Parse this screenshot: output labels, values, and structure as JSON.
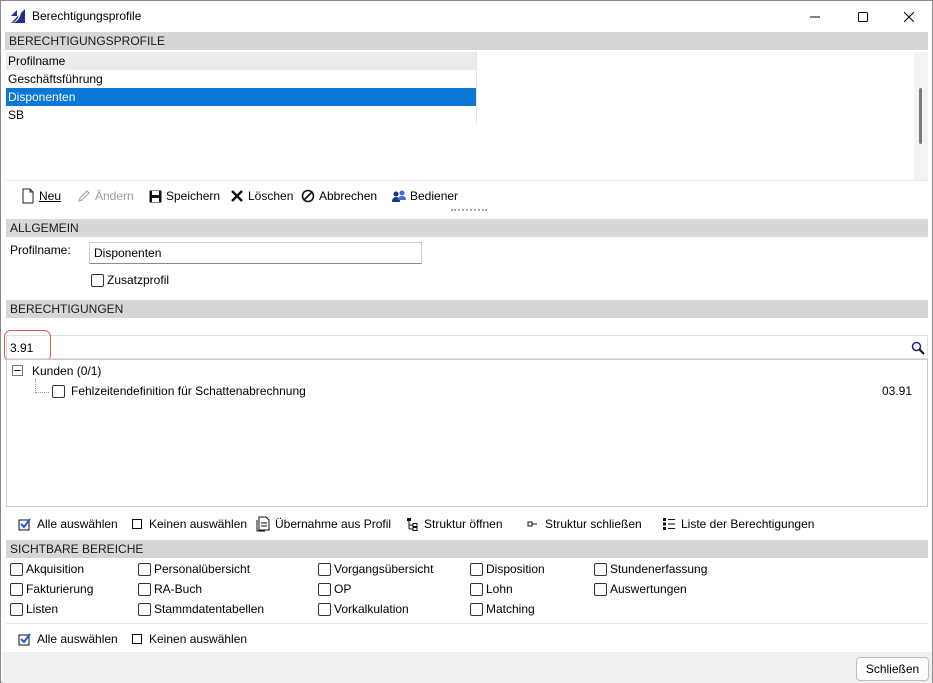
{
  "window": {
    "title": "Berechtigungsprofile",
    "controls": [
      "minimize",
      "maximize",
      "close"
    ]
  },
  "profiles": {
    "header": "BERECHTIGUNGSPROFILE",
    "column": "Profilname",
    "rows": [
      "Geschäftsführung",
      "Disponenten",
      "SB"
    ],
    "selected": "Disponenten"
  },
  "toolbar": {
    "new": "Neu",
    "edit": "Ändern",
    "save": "Speichern",
    "delete": "Löschen",
    "cancel": "Abbrechen",
    "users": "Bediener"
  },
  "general": {
    "header": "ALLGEMEIN",
    "profile_label": "Profilname:",
    "profile_value": "Disponenten",
    "additional_profile": "Zusatzprofil"
  },
  "permissions": {
    "header": "BERECHTIGUNGEN",
    "search_value": "3.91",
    "tree": {
      "group_label": "Kunden (0/1)",
      "items": [
        {
          "label": "Fehlzeitendefinition für Schattenabrechnung",
          "code": "03.91",
          "checked": false
        }
      ]
    },
    "actions": {
      "select_all": "Alle auswählen",
      "select_none": "Keinen auswählen",
      "copy_from_profile": "Übernahme aus Profil",
      "open_structure": "Struktur öffnen",
      "close_structure": "Struktur schließen",
      "list_permissions": "Liste der Berechtigungen"
    }
  },
  "visible_areas": {
    "header": "SICHTBARE BEREICHE",
    "col1": [
      "Akquisition",
      "Fakturierung",
      "Listen"
    ],
    "col2": [
      "Personalübersicht",
      "RA-Buch",
      "Stammdatentabellen"
    ],
    "col3": [
      "Vorgangsübersicht",
      "OP",
      "Vorkalkulation"
    ],
    "col4": [
      "Disposition",
      "Lohn",
      "Matching"
    ],
    "col5": [
      "Stundenerfassung",
      "Auswertungen"
    ],
    "select_all": "Alle auswählen",
    "select_none": "Keinen auswählen"
  },
  "footer": {
    "close": "Schließen"
  },
  "colors": {
    "selection": "#0a78d4",
    "section_header": "#d6d6d6",
    "search_highlight": "#e05555"
  }
}
